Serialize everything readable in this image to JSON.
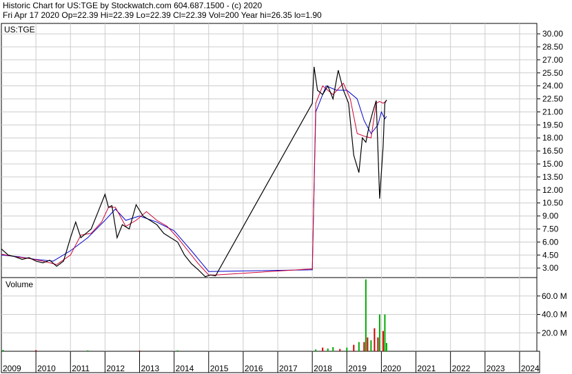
{
  "header": {
    "line1": "Historic Chart for US:TGE by Stockwatch.com 604.687.1500 - (c) 2020",
    "line2": "Fri Apr 17 2020  Op=22.39  Hi=22.39  Lo=22.39  Cl=22.39  Vol=200  Year hi=26.35  lo=1.90"
  },
  "colors": {
    "price": "#000000",
    "ma_short": "#cc0033",
    "ma_long": "#0000cc",
    "vol_up": "#00aa00",
    "vol_down": "#cc0000",
    "grid": "#cccccc"
  },
  "chart_data": [
    {
      "type": "line",
      "title": "US:TGE",
      "ylim": [
        1.9,
        31.2
      ],
      "yticks": [
        "30.00",
        "28.50",
        "27.00",
        "25.50",
        "24.00",
        "22.50",
        "21.00",
        "19.50",
        "18.00",
        "16.50",
        "15.00",
        "13.50",
        "12.00",
        "10.50",
        "9.00",
        "7.50",
        "6.00",
        "4.50",
        "3.00"
      ],
      "xlim": [
        2009.0,
        2024.5
      ],
      "xticks": [
        "2009",
        "2010",
        "2011",
        "2012",
        "2013",
        "2014",
        "2015",
        "2016",
        "2017",
        "2018",
        "2019",
        "2020",
        "2021",
        "2022",
        "2023",
        "2024"
      ],
      "series": [
        {
          "role": "price",
          "x": [
            2009.0,
            2009.2,
            2009.4,
            2009.6,
            2009.8,
            2010.0,
            2010.2,
            2010.4,
            2010.6,
            2010.8,
            2011.0,
            2011.15,
            2011.3,
            2011.45,
            2011.6,
            2011.8,
            2012.0,
            2012.1,
            2012.2,
            2012.35,
            2012.5,
            2012.7,
            2012.9,
            2013.1,
            2013.3,
            2013.5,
            2013.7,
            2013.9,
            2014.1,
            2014.3,
            2014.5,
            2014.7,
            2014.9,
            2015.05,
            2015.2,
            2018.0,
            2018.05,
            2018.15,
            2018.3,
            2018.45,
            2018.6,
            2018.75,
            2018.9,
            2019.05,
            2019.2,
            2019.35,
            2019.45,
            2019.55,
            2019.65,
            2019.75,
            2019.85,
            2019.95,
            2020.05,
            2020.1,
            2020.15
          ],
          "y": [
            5.2,
            4.5,
            4.3,
            4.0,
            4.2,
            3.8,
            3.6,
            3.9,
            3.2,
            3.8,
            6.5,
            8.3,
            6.5,
            7.0,
            7.5,
            9.5,
            11.5,
            10.0,
            10.2,
            6.5,
            8.0,
            7.5,
            10.3,
            9.0,
            8.5,
            8.0,
            7.0,
            6.5,
            6.0,
            4.5,
            3.5,
            2.8,
            2.0,
            2.2,
            2.1,
            22.0,
            26.2,
            23.5,
            23.0,
            24.0,
            22.5,
            25.8,
            23.5,
            22.0,
            16.0,
            14.0,
            18.0,
            17.5,
            19.5,
            21.0,
            22.3,
            11.0,
            17.0,
            22.0,
            22.39
          ]
        },
        {
          "role": "ma_short",
          "x": [
            2009.0,
            2009.4,
            2009.8,
            2010.2,
            2010.6,
            2011.0,
            2011.3,
            2011.6,
            2011.9,
            2012.1,
            2012.3,
            2012.6,
            2012.9,
            2013.2,
            2013.5,
            2013.8,
            2014.1,
            2014.4,
            2014.7,
            2015.0,
            2015.2,
            2018.0,
            2018.1,
            2018.3,
            2018.6,
            2018.9,
            2019.1,
            2019.3,
            2019.5,
            2019.7,
            2019.85,
            2019.95,
            2020.05,
            2020.15
          ],
          "y": [
            4.6,
            4.3,
            4.1,
            3.8,
            3.4,
            4.5,
            6.8,
            7.0,
            8.3,
            10.0,
            10.0,
            7.8,
            8.5,
            9.5,
            8.5,
            7.8,
            6.5,
            5.0,
            3.5,
            2.2,
            2.2,
            2.9,
            22.0,
            24.0,
            23.0,
            24.3,
            22.5,
            18.5,
            18.2,
            18.0,
            22.0,
            22.2,
            22.0,
            22.3
          ]
        },
        {
          "role": "ma_long",
          "x": [
            2009.0,
            2009.5,
            2010.0,
            2010.5,
            2011.0,
            2011.5,
            2012.0,
            2012.3,
            2012.6,
            2013.0,
            2013.5,
            2014.0,
            2014.5,
            2015.0,
            2018.0,
            2018.1,
            2018.4,
            2018.7,
            2019.0,
            2019.3,
            2019.5,
            2019.7,
            2019.9,
            2020.0,
            2020.1,
            2020.15
          ],
          "y": [
            4.5,
            4.3,
            4.0,
            3.8,
            5.0,
            6.5,
            8.5,
            9.8,
            8.5,
            9.0,
            8.3,
            7.3,
            5.0,
            2.6,
            2.8,
            21.0,
            24.0,
            23.5,
            23.5,
            22.5,
            20.0,
            18.5,
            19.5,
            21.0,
            20.2,
            20.5
          ]
        }
      ]
    },
    {
      "type": "bar",
      "title": "Volume",
      "ylim": [
        0,
        80
      ],
      "yticks": [
        "60.0 M",
        "40.0 M",
        "20.0 M"
      ],
      "x": [
        2009.05,
        2010.0,
        2011.5,
        2013.0,
        2014.1,
        2018.1,
        2018.3,
        2018.45,
        2018.6,
        2018.8,
        2019.0,
        2019.2,
        2019.35,
        2019.5,
        2019.55,
        2019.6,
        2019.7,
        2019.8,
        2019.9,
        2019.95,
        2020.05,
        2020.1,
        2020.15
      ],
      "values": [
        1.5,
        1.2,
        1.0,
        0.8,
        1.0,
        2.0,
        4.0,
        3.0,
        4.5,
        2.5,
        4.0,
        7.0,
        10.0,
        10.0,
        78.0,
        15.0,
        12.0,
        25.0,
        15.0,
        40.0,
        22.0,
        40.0,
        9.0
      ],
      "colors": [
        "green",
        "red",
        "green",
        "red",
        "green",
        "green",
        "red",
        "green",
        "green",
        "red",
        "green",
        "red",
        "green",
        "red",
        "green",
        "red",
        "green",
        "red",
        "red",
        "green",
        "red",
        "green",
        "green"
      ]
    }
  ]
}
